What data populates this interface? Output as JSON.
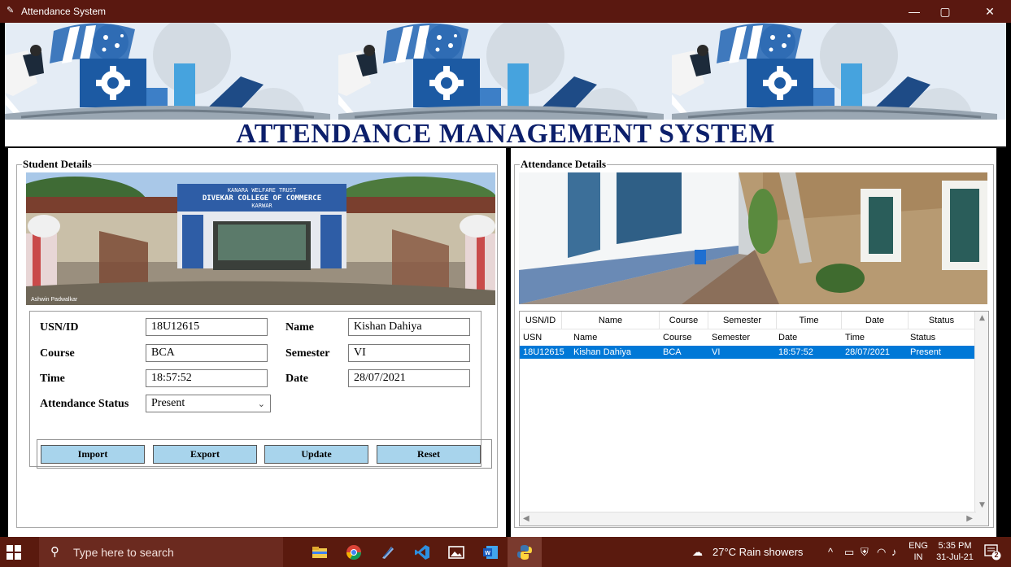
{
  "window": {
    "title": "Attendance System",
    "controls": [
      "—",
      "▢",
      "✕"
    ]
  },
  "heading": "ATTENDANCE MANAGEMENT SYSTEM",
  "student_details": {
    "group_label": "Student Details",
    "photo_text": {
      "sign_line1": "KANARA WELFARE TRUST",
      "sign_line2": "DIVEKAR COLLEGE OF COMMERCE",
      "sign_line3": "KARWAR",
      "credit": "Ashwin Padwalkar"
    },
    "form": {
      "usn_label": "USN/ID",
      "usn_value": "18U12615",
      "name_label": "Name",
      "name_value": "Kishan Dahiya",
      "course_label": "Course",
      "course_value": "BCA",
      "semester_label": "Semester",
      "semester_value": "VI",
      "time_label": "Time",
      "time_value": "18:57:52",
      "date_label": "Date",
      "date_value": "28/07/2021",
      "status_label": "Attendance Status",
      "status_value": "Present"
    },
    "buttons": {
      "import": "Import",
      "export": "Export",
      "update": "Update",
      "reset": "Reset"
    }
  },
  "attendance_details": {
    "group_label": "Attendance Details",
    "columns": [
      "USN/ID",
      "Name",
      "Course",
      "Semester",
      "Time",
      "Date",
      "Status"
    ],
    "rows": [
      [
        "USN",
        "Name",
        "Course",
        "Semester",
        "Date",
        "Time",
        "Status"
      ],
      [
        "18U12615",
        "Kishan Dahiya",
        "BCA",
        "VI",
        "18:57:52",
        "28/07/2021",
        "Present"
      ]
    ],
    "selected_row": 1
  },
  "taskbar": {
    "search_placeholder": "Type here to search",
    "weather": "27°C  Rain showers",
    "lang_top": "ENG",
    "lang_bottom": "IN",
    "time": "5:35 PM",
    "date": "31-Jul-21",
    "notifications": "2",
    "tray_chevron": "^"
  },
  "colors": {
    "titlebar": "#5a1810",
    "heading_text": "#0c1f6b",
    "button_fill": "#a8d4ec",
    "row_selected": "#0078d7",
    "taskbar": "#5a1a0e"
  }
}
